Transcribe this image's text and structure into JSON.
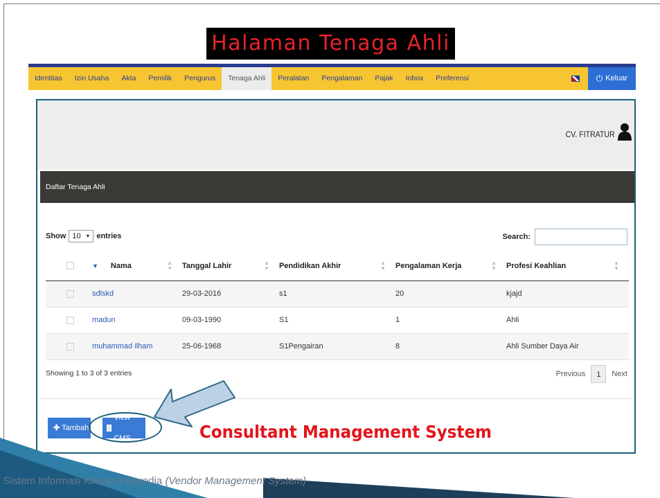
{
  "slide_title": "Halaman Tenaga Ahli",
  "nav": {
    "items": [
      "Identitas",
      "Izin Usaha",
      "Akta",
      "Pemilik",
      "Pengurus",
      "Tenaga Ahli",
      "Peralatan",
      "Pengalaman",
      "Pajak",
      "Inbox",
      "Preferensi"
    ],
    "active": "Tenaga Ahli",
    "logout_label": "Keluar",
    "flag_icon": "uk-flag-icon"
  },
  "profile": {
    "company_name": "CV. FITRATUR"
  },
  "list_title": "Daftar Tenaga Ahli",
  "table_controls": {
    "show_label": "Show",
    "page_size": "10",
    "entries_label": "entries",
    "search_label": "Search:",
    "search_value": ""
  },
  "table": {
    "columns": [
      "Nama",
      "Tanggal Lahir",
      "Pendidikan Akhir",
      "Pengalaman Kerja",
      "Profesi Keahlian"
    ],
    "rows": [
      [
        "sdlskd",
        "29-03-2016",
        "s1",
        "20",
        "kjajd"
      ],
      [
        "madun",
        "09-03-1990",
        "S1",
        "1",
        "Ahli"
      ],
      [
        "muhammad ilham",
        "25-06-1968",
        "S1Pengairan",
        "8",
        "Ahli Sumber Daya Air"
      ]
    ]
  },
  "pagination": {
    "info": "Showing 1 to 3 of 3 entries",
    "previous": "Previous",
    "current_page": "1",
    "next": "Next"
  },
  "buttons": {
    "add": "Tambah",
    "view_cms": "View CMS"
  },
  "callout": "Consultant Management System",
  "footer": {
    "text": "Sistem Informasi Kinerja Penyedia",
    "italic": "(Vendor Management System)"
  },
  "colors": {
    "navbar": "#f6c531",
    "navbar_top": "#2a3b8f",
    "accent_blue": "#3a7bd5",
    "title_red": "#e8232a",
    "callout_red": "#e3141c",
    "frame_teal": "#1c5f7a"
  }
}
